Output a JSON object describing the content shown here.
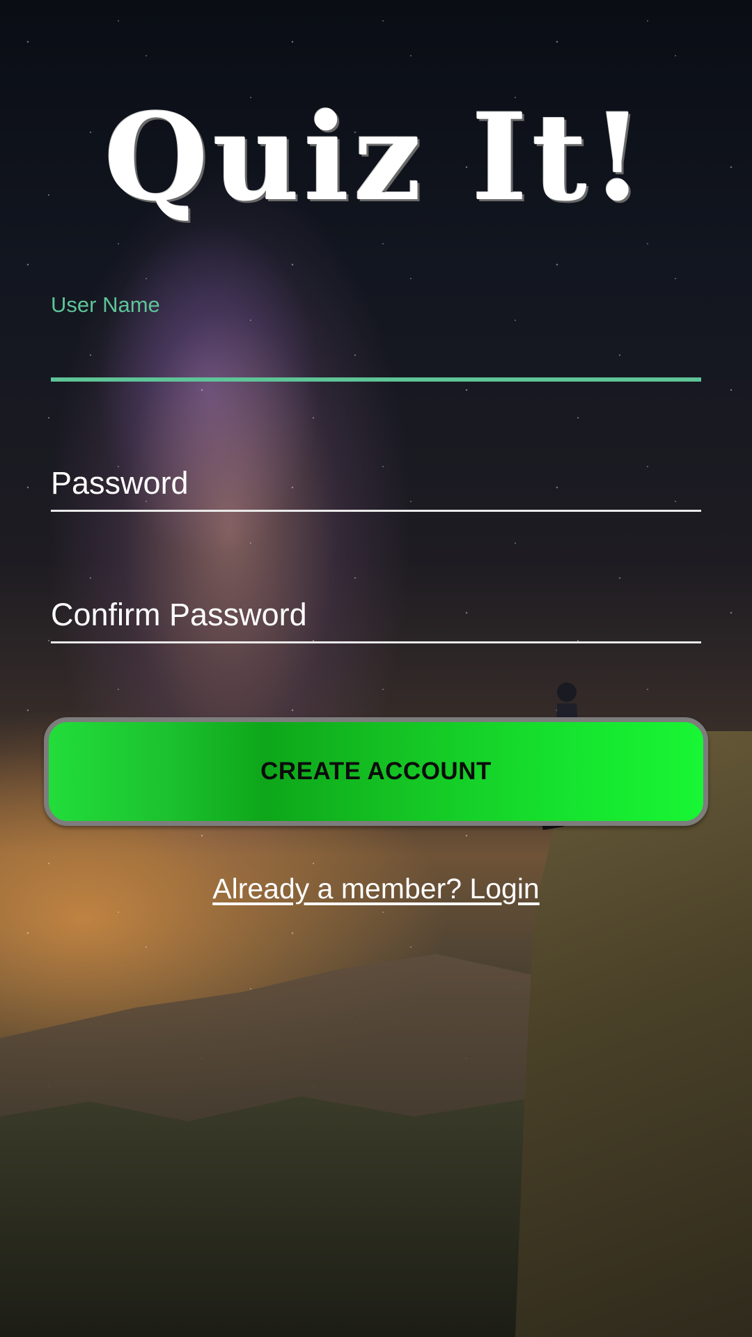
{
  "app": {
    "title": "Quiz It!"
  },
  "form": {
    "username": {
      "label": "User Name",
      "value": ""
    },
    "password": {
      "placeholder": "Password",
      "value": ""
    },
    "confirm_password": {
      "placeholder": "Confirm Password",
      "value": ""
    },
    "create_button_label": "CREATE ACCOUNT",
    "login_link_label": "Already a member? Login"
  },
  "colors": {
    "accent_field": "#5ec497",
    "button_green": "#16e42f",
    "button_border": "#7d7d7d",
    "text": "#ffffff"
  },
  "background": {
    "icon": "night-sky-milky-way-cliff-photo"
  }
}
